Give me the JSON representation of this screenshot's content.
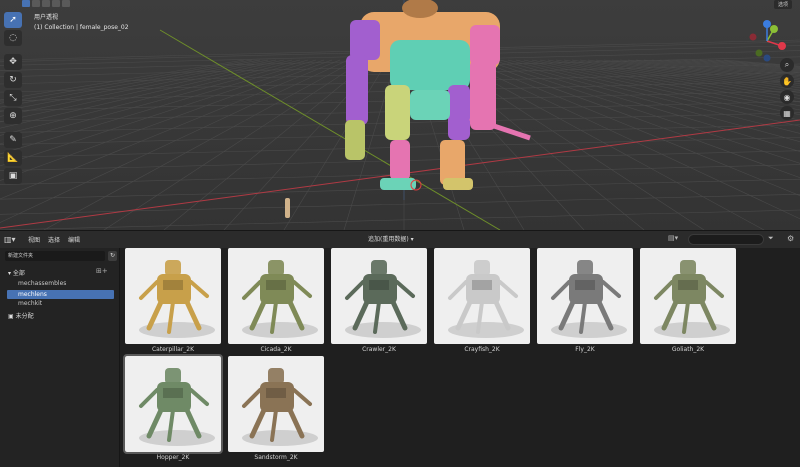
{
  "viewport": {
    "mode_line": "用户透视",
    "collection_line": "(1) Collection | female_pose_02",
    "header_right": "选项",
    "tools": [
      "select-tool",
      "cursor-tool",
      "move-tool",
      "rotate-tool",
      "scale-tool",
      "transform-tool",
      "annotate-tool",
      "measure-tool",
      "add-cube-tool"
    ],
    "gizmo_axes": {
      "x": "X",
      "y": "Y",
      "z": "Z"
    },
    "colors": {
      "x_axis": "#e0384a",
      "y_axis": "#8bbf36",
      "z_axis": "#3b7de0"
    }
  },
  "asset_header": {
    "menus": [
      "视图",
      "选择",
      "编辑"
    ],
    "library": "追加(重用数据)",
    "search_placeholder": ""
  },
  "sidebar": {
    "library_select": "新建文件夹",
    "all_label": "全部",
    "categories": [
      "mechassembles",
      "mechlens",
      "mechkit"
    ],
    "selected_category": 1,
    "unassigned_label": "未分配"
  },
  "assets": [
    {
      "name": "Caterpillar_2K",
      "tint": "#c8a04a"
    },
    {
      "name": "Cicada_2K",
      "tint": "#7f8a57"
    },
    {
      "name": "Crawler_2K",
      "tint": "#5b6a5a"
    },
    {
      "name": "Crayfish_2K",
      "tint": "#c9c9c9"
    },
    {
      "name": "Fly_2K",
      "tint": "#7a7a7a"
    },
    {
      "name": "Goliath_2K",
      "tint": "#7d8762"
    },
    {
      "name": "Hopper_2K",
      "tint": "#6f8a66"
    },
    {
      "name": "Sandstorm_2K",
      "tint": "#8a7355"
    }
  ],
  "colors": {
    "accent": "#4772b3",
    "bg": "#1d1d1d"
  }
}
